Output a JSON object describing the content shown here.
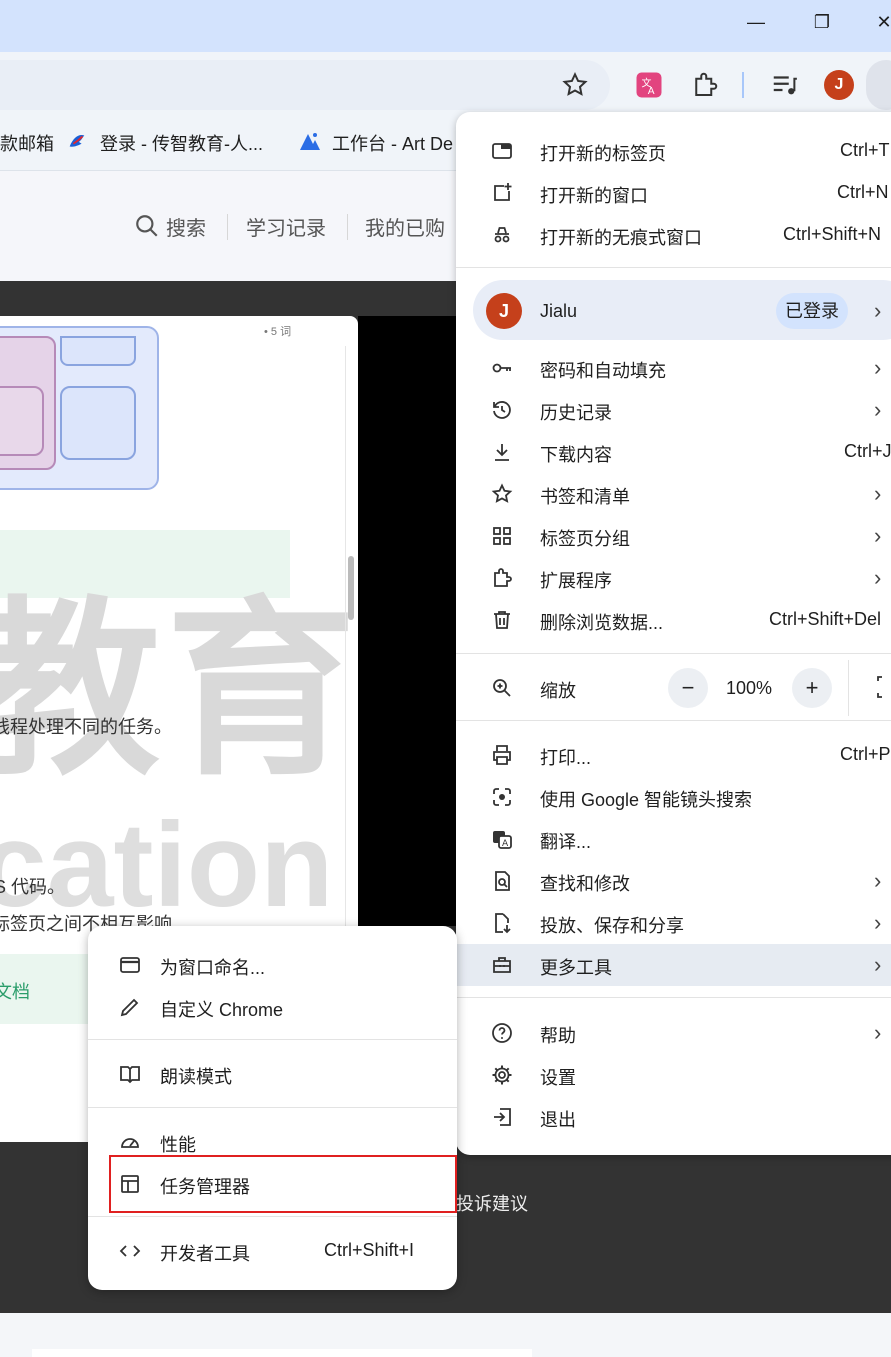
{
  "window": {
    "minimize_glyph": "—",
    "restore_glyph": "❐",
    "close_glyph": "✕"
  },
  "toolbar": {
    "profile_initial": "J",
    "icons": [
      "star-icon",
      "translate-icon",
      "extensions-icon",
      "media-icon",
      "profile-avatar",
      "menu-icon"
    ]
  },
  "bookmarks": [
    {
      "label": "款邮箱"
    },
    {
      "label": "登录 - 传智教育-人..."
    },
    {
      "label": "工作台 - Art De"
    }
  ],
  "page": {
    "nav": {
      "search": "搜索",
      "history": "学习记录",
      "purchased": "我的已购"
    },
    "word_count": "• 5 词",
    "watermark_1": "教育",
    "watermark_2": "cation",
    "doc_lines": [
      "线程处理不同的任务。",
      "S 代码。",
      "标签页之间不相互影响"
    ],
    "doc_link": "文档",
    "footer_link": "投诉建议"
  },
  "menu": {
    "new_tab": {
      "label": "打开新的标签页",
      "shortcut": "Ctrl+T"
    },
    "new_window": {
      "label": "打开新的窗口",
      "shortcut": "Ctrl+N"
    },
    "incognito": {
      "label": "打开新的无痕式窗口",
      "shortcut": "Ctrl+Shift+N"
    },
    "profile": {
      "initial": "J",
      "name": "Jialu",
      "status": "已登录"
    },
    "passwords": {
      "label": "密码和自动填充"
    },
    "history": {
      "label": "历史记录"
    },
    "downloads": {
      "label": "下载内容",
      "shortcut": "Ctrl+J"
    },
    "bookmarks": {
      "label": "书签和清单"
    },
    "tab_groups": {
      "label": "标签页分组"
    },
    "extensions": {
      "label": "扩展程序"
    },
    "clear_data": {
      "label": "删除浏览数据...",
      "shortcut": "Ctrl+Shift+Del"
    },
    "zoom": {
      "label": "缩放",
      "minus": "−",
      "value": "100%",
      "plus": "+"
    },
    "print": {
      "label": "打印...",
      "shortcut": "Ctrl+P"
    },
    "lens": {
      "label": "使用 Google 智能镜头搜索"
    },
    "translate": {
      "label": "翻译..."
    },
    "find": {
      "label": "查找和修改"
    },
    "cast": {
      "label": "投放、保存和分享"
    },
    "more_tools": {
      "label": "更多工具"
    },
    "help": {
      "label": "帮助"
    },
    "settings": {
      "label": "设置"
    },
    "exit": {
      "label": "退出"
    }
  },
  "submenu": {
    "name_window": {
      "label": "为窗口命名..."
    },
    "customize": {
      "label": "自定义 Chrome"
    },
    "reading_mode": {
      "label": "朗读模式"
    },
    "performance": {
      "label": "性能"
    },
    "task_manager": {
      "label": "任务管理器"
    },
    "dev_tools": {
      "label": "开发者工具",
      "shortcut": "Ctrl+Shift+I"
    }
  },
  "colors": {
    "highlight": "#e02020",
    "accent": "#d3e3fd",
    "avatar": "#c5401b"
  }
}
